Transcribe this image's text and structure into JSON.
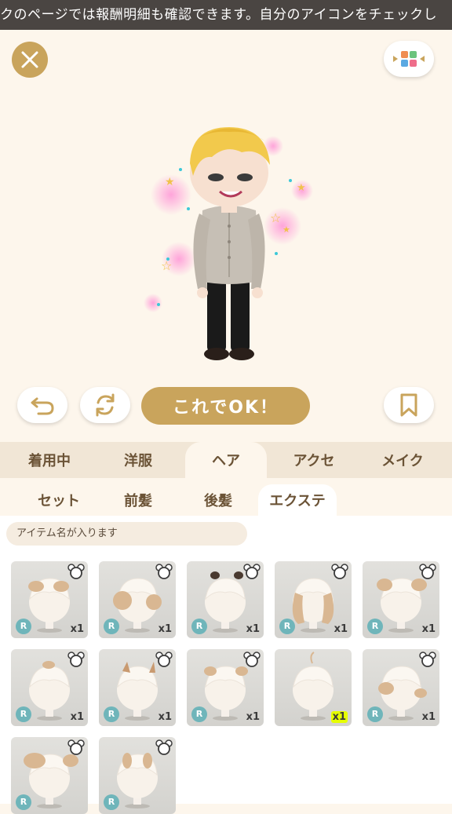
{
  "ticker": {
    "text": "クのページでは報酬明細も確認できます。自分のアイコンをチェックし"
  },
  "header": {
    "close_icon": "close-icon",
    "layout_icon": "layout-grid-icon"
  },
  "actions": {
    "undo_icon": "undo-icon",
    "refresh_icon": "refresh-icon",
    "ok_label": "これでOK！",
    "bookmark_icon": "bookmark-icon"
  },
  "main_tabs": [
    {
      "label": "着用中"
    },
    {
      "label": "洋服"
    },
    {
      "label": "ヘア",
      "active": true
    },
    {
      "label": "アクセ"
    },
    {
      "label": "メイク"
    }
  ],
  "sub_tabs": [
    {
      "label": "セット"
    },
    {
      "label": "前髪"
    },
    {
      "label": "後髪"
    },
    {
      "label": "エクステ",
      "active": true
    }
  ],
  "item_name": "アイテム名が入ります",
  "items": [
    {
      "rarity": "R",
      "qty": "x1"
    },
    {
      "rarity": "R",
      "qty": "x1"
    },
    {
      "rarity": "R",
      "qty": "x1"
    },
    {
      "rarity": "R",
      "qty": "x1"
    },
    {
      "rarity": "R",
      "qty": "x1"
    },
    {
      "rarity": "R",
      "qty": "x1"
    },
    {
      "rarity": "R",
      "qty": "x1"
    },
    {
      "rarity": "R",
      "qty": "x1"
    },
    {
      "rarity": "",
      "qty": "x1"
    },
    {
      "rarity": "R",
      "qty": "x1"
    },
    {
      "rarity": "R",
      "qty": ""
    },
    {
      "rarity": "R",
      "qty": ""
    }
  ],
  "colors": {
    "accent": "#c9a45c",
    "tab_bg": "#f1e6d6",
    "rarity_badge": "#6fb5ba",
    "highlight": "#e6ff00"
  }
}
